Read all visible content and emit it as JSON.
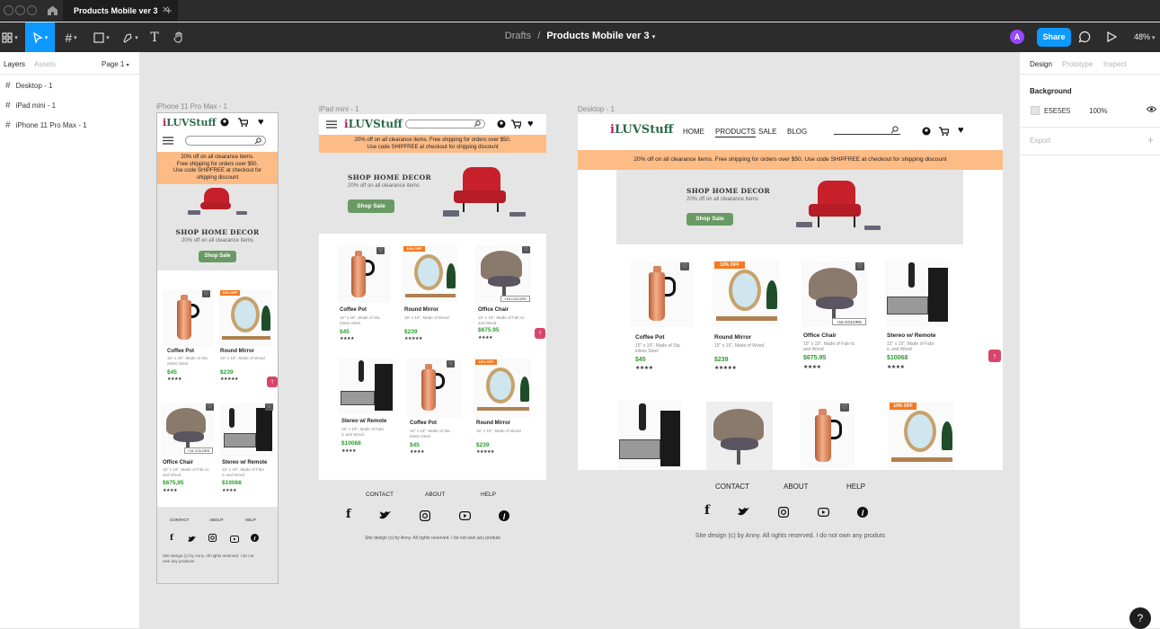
{
  "app": {
    "tab_title": "Products Mobile ver 3",
    "breadcrumb_parent": "Drafts",
    "breadcrumb_sep": "/",
    "file_title": "Products Mobile ver 3",
    "avatar_initial": "A",
    "share_label": "Share",
    "zoom": "48%",
    "help": "?"
  },
  "left_panel": {
    "tabs": [
      "Layers",
      "Assets"
    ],
    "page": "Page 1",
    "layers": [
      "Desktop - 1",
      "iPad mini - 1",
      "iPhone 11 Pro Max - 1"
    ]
  },
  "right_panel": {
    "tabs": [
      "Design",
      "Prototype",
      "Inspect"
    ],
    "background_label": "Background",
    "background_hex": "E5E5E5",
    "background_opacity": "100%",
    "export_label": "Export",
    "background_color": "#E5E5E5"
  },
  "frames": {
    "iphone_label": "iPhone 11 Pro Max - 1",
    "ipad_label": "iPad mini - 1",
    "desktop_label": "Desktop - 1"
  },
  "site": {
    "logo_i": "i",
    "logo_rest": "LUVStuff",
    "nav": [
      "HOME",
      "PRODUCTS",
      "SALE",
      "BLOG"
    ],
    "banner": "20% off on all clearance items. Free shipping for orders over $50. Use code SHIPFREE at checkout for shipping discount",
    "banner_ipad_1": "20% off on all clearance items. Free shipping for orders over $50.",
    "banner_ipad_2": "Use code SHIPFREE at checkout for shipping discount",
    "banner_iphone_1": "20% off on all clearance items.",
    "banner_iphone_2": "Free shipping for orders over $50.",
    "banner_iphone_3": "Use code SHIPFREE at checkout for",
    "banner_iphone_4": "shipping discount",
    "hero_title": "SHOP HOME DECOR",
    "hero_sub": "20% off on all clearance items",
    "hero_button": "Shop Sale",
    "off_badge": "10% OFF",
    "colors_badge": "+15 COLORS",
    "products": {
      "pot": {
        "name": "Coffee Pot",
        "desc1": "15\" x 19\", Made of Sta",
        "desc2": "inless Steel",
        "price": "$45",
        "stars": "★★★★"
      },
      "mirror": {
        "name": "Round Mirror",
        "desc1": "15\" x 19\", Made of Wood",
        "desc2": "",
        "price": "$239",
        "stars": "★★★★★"
      },
      "chair": {
        "name": "Office Chair",
        "desc1": "15\" x 19\", Made of Fab ric",
        "desc2": "and Wood",
        "price": "$675.95",
        "stars": "★★★★"
      },
      "chair_iphone_price": "$675,95",
      "stereo": {
        "name": "Stereo w/ Remote",
        "desc1": "15\" x 19\", Made of Fabr",
        "desc2": "ic and Wood",
        "price": "$10068",
        "stars": "★★★★"
      }
    },
    "footer": [
      "CONTACT",
      "ABOUT",
      "HELP"
    ],
    "social": [
      "f",
      "t",
      "ig",
      "yt",
      "p"
    ],
    "copyright": "Site design (c) by Anny. All rights reserved. I do not own any produts",
    "copyright_ipad": "Site design (c) by Anny. All rights reserved. I do not own any produts",
    "copyright_iphone_1": "Site design (c) by Anny. All rights reserved. I do not",
    "copyright_iphone_2": "own any products"
  }
}
